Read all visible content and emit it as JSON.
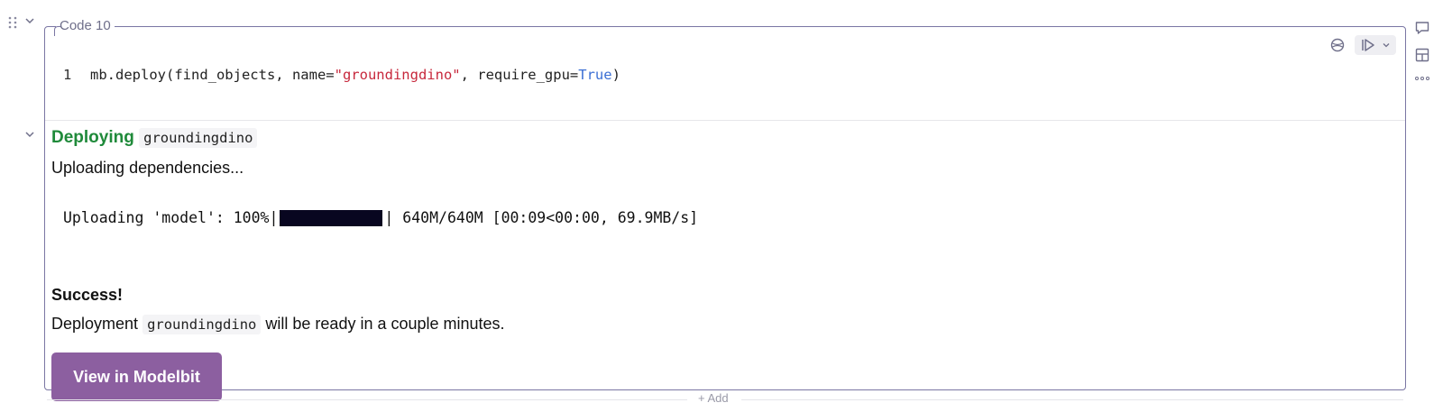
{
  "cell": {
    "label": "Code 10",
    "line_number": "1",
    "code": {
      "call_prefix": "mb.deploy(find_objects, name=",
      "name_string": "\"groundingdino\"",
      "kwarg": ", require_gpu=",
      "kwarg_value": "True",
      "closing": ")"
    }
  },
  "output": {
    "deploying_label": "Deploying",
    "deployment_name": "groundingdino",
    "uploading_text": "Uploading dependencies...",
    "progress": {
      "prefix": "Uploading 'model': 100%",
      "left_sep": "|",
      "right_sep": "|",
      "suffix": " 640M/640M [00:09<00:00, 69.9MB/s]",
      "fraction": 1.0
    },
    "success_label": "Success!",
    "ready_prefix": "Deployment",
    "ready_name": "groundingdino",
    "ready_suffix": "will be ready in a couple minutes.",
    "button_label": "View in Modelbit"
  },
  "add_row": {
    "label": "+ Add"
  },
  "colors": {
    "accent": "#8c5fa0",
    "success": "#1f8a3a",
    "string": "#c7283c",
    "keyword": "#3b6fd4",
    "progress_fill": "#080620"
  }
}
